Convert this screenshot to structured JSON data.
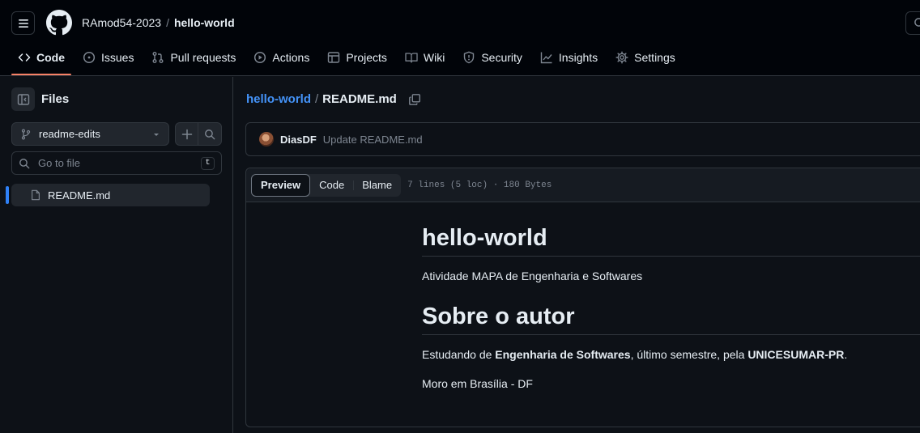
{
  "header": {
    "owner": "RAmod54-2023",
    "separator": "/",
    "repo": "hello-world"
  },
  "tabs": [
    {
      "label": "Code",
      "icon": "code-icon",
      "active": true
    },
    {
      "label": "Issues",
      "icon": "issue-icon"
    },
    {
      "label": "Pull requests",
      "icon": "pull-request-icon"
    },
    {
      "label": "Actions",
      "icon": "play-icon"
    },
    {
      "label": "Projects",
      "icon": "table-icon"
    },
    {
      "label": "Wiki",
      "icon": "book-icon"
    },
    {
      "label": "Security",
      "icon": "shield-icon"
    },
    {
      "label": "Insights",
      "icon": "graph-icon"
    },
    {
      "label": "Settings",
      "icon": "gear-icon"
    }
  ],
  "sidebar": {
    "title": "Files",
    "branch": "readme-edits",
    "goto_placeholder": "Go to file",
    "goto_shortcut": "t",
    "files": [
      {
        "name": "README.md",
        "selected": true
      }
    ]
  },
  "path": {
    "repo": "hello-world",
    "separator": "/",
    "file": "README.md"
  },
  "commit": {
    "author": "DiasDF",
    "message": "Update README.md"
  },
  "viewer": {
    "modes": [
      "Preview",
      "Code",
      "Blame"
    ],
    "active_mode": "Preview",
    "meta": "7 lines (5 loc) · 180 Bytes"
  },
  "readme": {
    "h1": "hello-world",
    "p1": "Atividade MAPA de Engenharia e Softwares",
    "h2": "Sobre o autor",
    "p2_pre": "Estudando de ",
    "p2_bold1": "Engenharia de Softwares",
    "p2_mid": ", último semestre, pela ",
    "p2_bold2": "UNICESUMAR-PR",
    "p2_post": ".",
    "p3": "Moro em Brasília - DF"
  },
  "colors": {
    "accent_link": "#4493f8",
    "active_tab_underline": "#f78166",
    "background": "#0d1117"
  }
}
